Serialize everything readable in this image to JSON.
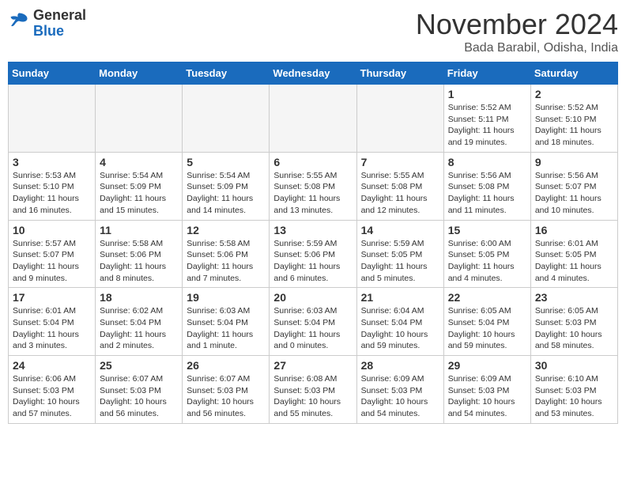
{
  "header": {
    "logo_general": "General",
    "logo_blue": "Blue",
    "month_title": "November 2024",
    "location": "Bada Barabil, Odisha, India"
  },
  "days_of_week": [
    "Sunday",
    "Monday",
    "Tuesday",
    "Wednesday",
    "Thursday",
    "Friday",
    "Saturday"
  ],
  "weeks": [
    [
      {
        "day": "",
        "info": ""
      },
      {
        "day": "",
        "info": ""
      },
      {
        "day": "",
        "info": ""
      },
      {
        "day": "",
        "info": ""
      },
      {
        "day": "",
        "info": ""
      },
      {
        "day": "1",
        "info": "Sunrise: 5:52 AM\nSunset: 5:11 PM\nDaylight: 11 hours and 19 minutes."
      },
      {
        "day": "2",
        "info": "Sunrise: 5:52 AM\nSunset: 5:10 PM\nDaylight: 11 hours and 18 minutes."
      }
    ],
    [
      {
        "day": "3",
        "info": "Sunrise: 5:53 AM\nSunset: 5:10 PM\nDaylight: 11 hours and 16 minutes."
      },
      {
        "day": "4",
        "info": "Sunrise: 5:54 AM\nSunset: 5:09 PM\nDaylight: 11 hours and 15 minutes."
      },
      {
        "day": "5",
        "info": "Sunrise: 5:54 AM\nSunset: 5:09 PM\nDaylight: 11 hours and 14 minutes."
      },
      {
        "day": "6",
        "info": "Sunrise: 5:55 AM\nSunset: 5:08 PM\nDaylight: 11 hours and 13 minutes."
      },
      {
        "day": "7",
        "info": "Sunrise: 5:55 AM\nSunset: 5:08 PM\nDaylight: 11 hours and 12 minutes."
      },
      {
        "day": "8",
        "info": "Sunrise: 5:56 AM\nSunset: 5:08 PM\nDaylight: 11 hours and 11 minutes."
      },
      {
        "day": "9",
        "info": "Sunrise: 5:56 AM\nSunset: 5:07 PM\nDaylight: 11 hours and 10 minutes."
      }
    ],
    [
      {
        "day": "10",
        "info": "Sunrise: 5:57 AM\nSunset: 5:07 PM\nDaylight: 11 hours and 9 minutes."
      },
      {
        "day": "11",
        "info": "Sunrise: 5:58 AM\nSunset: 5:06 PM\nDaylight: 11 hours and 8 minutes."
      },
      {
        "day": "12",
        "info": "Sunrise: 5:58 AM\nSunset: 5:06 PM\nDaylight: 11 hours and 7 minutes."
      },
      {
        "day": "13",
        "info": "Sunrise: 5:59 AM\nSunset: 5:06 PM\nDaylight: 11 hours and 6 minutes."
      },
      {
        "day": "14",
        "info": "Sunrise: 5:59 AM\nSunset: 5:05 PM\nDaylight: 11 hours and 5 minutes."
      },
      {
        "day": "15",
        "info": "Sunrise: 6:00 AM\nSunset: 5:05 PM\nDaylight: 11 hours and 4 minutes."
      },
      {
        "day": "16",
        "info": "Sunrise: 6:01 AM\nSunset: 5:05 PM\nDaylight: 11 hours and 4 minutes."
      }
    ],
    [
      {
        "day": "17",
        "info": "Sunrise: 6:01 AM\nSunset: 5:04 PM\nDaylight: 11 hours and 3 minutes."
      },
      {
        "day": "18",
        "info": "Sunrise: 6:02 AM\nSunset: 5:04 PM\nDaylight: 11 hours and 2 minutes."
      },
      {
        "day": "19",
        "info": "Sunrise: 6:03 AM\nSunset: 5:04 PM\nDaylight: 11 hours and 1 minute."
      },
      {
        "day": "20",
        "info": "Sunrise: 6:03 AM\nSunset: 5:04 PM\nDaylight: 11 hours and 0 minutes."
      },
      {
        "day": "21",
        "info": "Sunrise: 6:04 AM\nSunset: 5:04 PM\nDaylight: 10 hours and 59 minutes."
      },
      {
        "day": "22",
        "info": "Sunrise: 6:05 AM\nSunset: 5:04 PM\nDaylight: 10 hours and 59 minutes."
      },
      {
        "day": "23",
        "info": "Sunrise: 6:05 AM\nSunset: 5:03 PM\nDaylight: 10 hours and 58 minutes."
      }
    ],
    [
      {
        "day": "24",
        "info": "Sunrise: 6:06 AM\nSunset: 5:03 PM\nDaylight: 10 hours and 57 minutes."
      },
      {
        "day": "25",
        "info": "Sunrise: 6:07 AM\nSunset: 5:03 PM\nDaylight: 10 hours and 56 minutes."
      },
      {
        "day": "26",
        "info": "Sunrise: 6:07 AM\nSunset: 5:03 PM\nDaylight: 10 hours and 56 minutes."
      },
      {
        "day": "27",
        "info": "Sunrise: 6:08 AM\nSunset: 5:03 PM\nDaylight: 10 hours and 55 minutes."
      },
      {
        "day": "28",
        "info": "Sunrise: 6:09 AM\nSunset: 5:03 PM\nDaylight: 10 hours and 54 minutes."
      },
      {
        "day": "29",
        "info": "Sunrise: 6:09 AM\nSunset: 5:03 PM\nDaylight: 10 hours and 54 minutes."
      },
      {
        "day": "30",
        "info": "Sunrise: 6:10 AM\nSunset: 5:03 PM\nDaylight: 10 hours and 53 minutes."
      }
    ]
  ]
}
